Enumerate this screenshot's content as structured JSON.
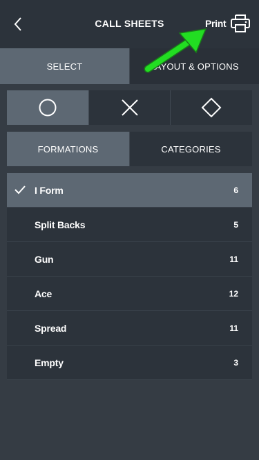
{
  "header": {
    "title": "CALL SHEETS",
    "print_label": "Print",
    "back_icon": "chevron-left-icon",
    "print_icon": "printer-icon"
  },
  "tabs": [
    {
      "label": "SELECT",
      "active": true
    },
    {
      "label": "LAYOUT & OPTIONS",
      "active": false
    }
  ],
  "shape_filters": [
    {
      "icon": "circle-icon",
      "active": true
    },
    {
      "icon": "x-icon",
      "active": false
    },
    {
      "icon": "diamond-icon",
      "active": false
    }
  ],
  "segments": [
    {
      "label": "FORMATIONS",
      "active": true
    },
    {
      "label": "CATEGORIES",
      "active": false
    }
  ],
  "formations": [
    {
      "label": "I Form",
      "count": "6",
      "selected": true
    },
    {
      "label": "Split Backs",
      "count": "5",
      "selected": false
    },
    {
      "label": "Gun",
      "count": "11",
      "selected": false
    },
    {
      "label": "Ace",
      "count": "12",
      "selected": false
    },
    {
      "label": "Spread",
      "count": "11",
      "selected": false
    },
    {
      "label": "Empty",
      "count": "3",
      "selected": false
    }
  ],
  "colors": {
    "background": "#353c44",
    "header": "#2c333b",
    "active": "#5d6873",
    "annotation_arrow": "#22dd22"
  }
}
